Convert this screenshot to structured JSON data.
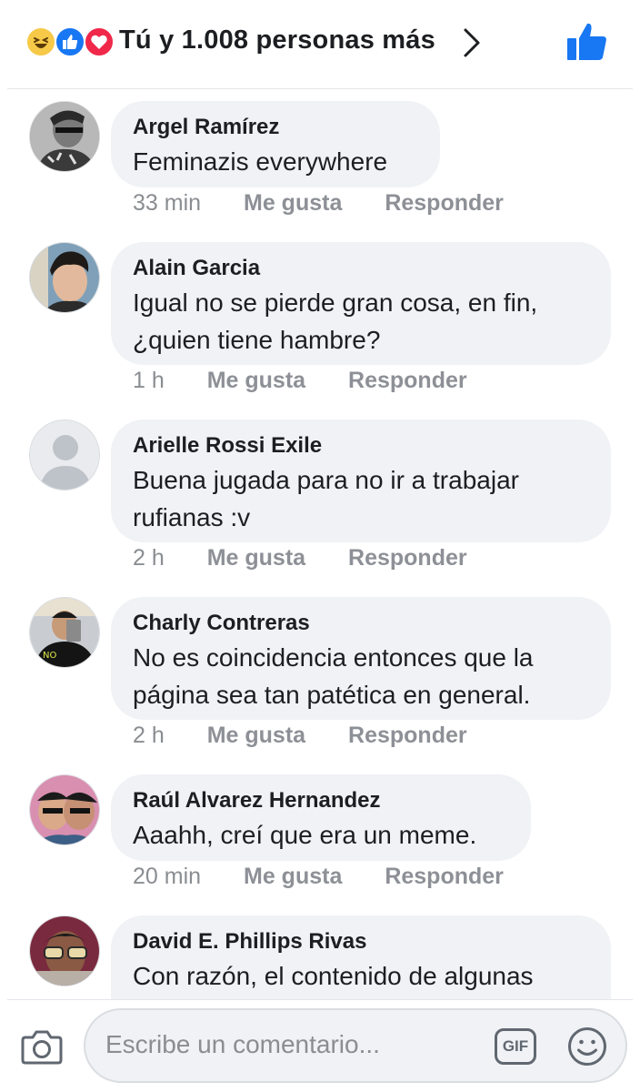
{
  "header": {
    "reactions_text": "Tú y 1.008 personas más",
    "reaction_icons": [
      "haha-icon",
      "like-icon",
      "love-icon"
    ]
  },
  "comments": [
    {
      "author": "Argel Ramírez",
      "text": "Feminazis everywhere",
      "time": "33 min",
      "like": "Me gusta",
      "reply": "Responder"
    },
    {
      "author": "Alain Garcia",
      "text": "Igual no se pierde gran cosa, en fin, ¿quien  tiene hambre?",
      "time": "1 h",
      "like": "Me gusta",
      "reply": "Responder"
    },
    {
      "author": "Arielle Rossi Exile",
      "text": "Buena jugada para no ir a trabajar rufianas :v",
      "time": "2 h",
      "like": "Me gusta",
      "reply": "Responder"
    },
    {
      "author": "Charly Contreras",
      "text": "No es coincidencia entonces que la página sea tan patética en general.",
      "time": "2 h",
      "like": "Me gusta",
      "reply": "Responder"
    },
    {
      "author": "Raúl Alvarez Hernandez",
      "text": "Aaahh, creí que era un meme.",
      "time": "20 min",
      "like": "Me gusta",
      "reply": "Responder"
    },
    {
      "author": "David E. Phillips Rivas",
      "text": "Con razón, el contenido de algunas",
      "time": "",
      "like": "",
      "reply": ""
    }
  ],
  "composer": {
    "placeholder": "Escribe un comentario...",
    "gif_label": "GIF"
  },
  "colors": {
    "bubble": "#f0f2f5",
    "meta_text": "#8a8d91",
    "like_blue": "#1877f2"
  }
}
